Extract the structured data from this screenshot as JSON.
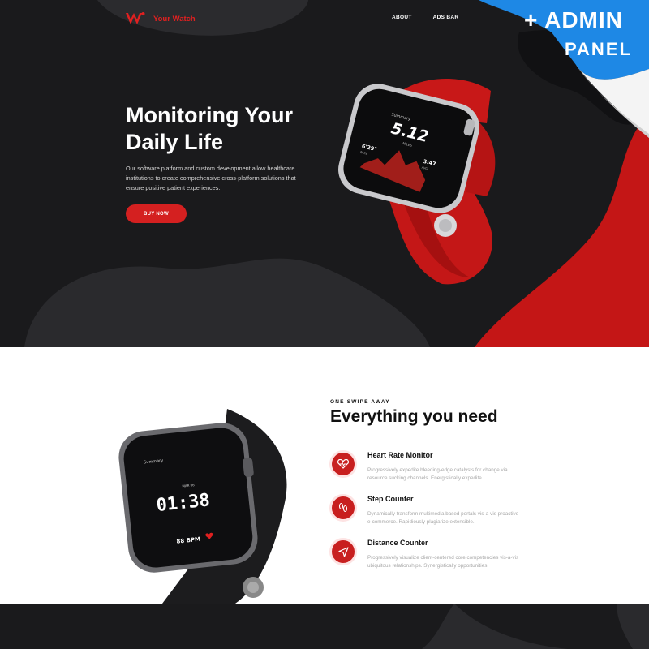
{
  "brand": {
    "name": "Your Watch",
    "accent": "#e02020"
  },
  "nav": {
    "items": [
      "ABOUT",
      "ADS BAR"
    ]
  },
  "hero": {
    "title": "Monitoring Your Daily Life",
    "description": "Our software platform and custom development allow healthcare institutions to create comprehensive cross-platform solutions that ensure positive patient experiences.",
    "cta": "BUY NOW",
    "watch_screen": {
      "header": "Summary",
      "value": "5.12",
      "unit": "MILES",
      "left_stat": "6'29\"",
      "left_stat_label": "PACE",
      "right_stat": "3:47",
      "right_stat_label": "AVG"
    }
  },
  "badge": {
    "line1": "+ ADMIN",
    "line2": "PANEL",
    "color": "#1e88e5"
  },
  "features": {
    "eyebrow": "ONE SWIPE AWAY",
    "title": "Everything you need",
    "items": [
      {
        "title": "Heart Rate Monitor",
        "description": "Progressively expedite bleeding-edge catalysts for change via resource sucking channels. Energistically expedite.",
        "icon": "heart-rate-icon"
      },
      {
        "title": "Step Counter",
        "description": "Dynamically transform multimedia based portals vis-a-vis proactive e-commerce. Rapidiously plagiarize extensible.",
        "icon": "footsteps-icon"
      },
      {
        "title": "Distance Counter",
        "description": "Progressively visualize client-centered core competencies vis-a-vis ubiquitous relationships. Synergistically opportunities.",
        "icon": "navigation-arrow-icon"
      }
    ],
    "watch_screen": {
      "header": "Summary",
      "date": "MAR 06",
      "time": "01:38",
      "bpm": "88 BPM"
    }
  },
  "colors": {
    "dark": "#1a1a1c",
    "red": "#d42020"
  }
}
